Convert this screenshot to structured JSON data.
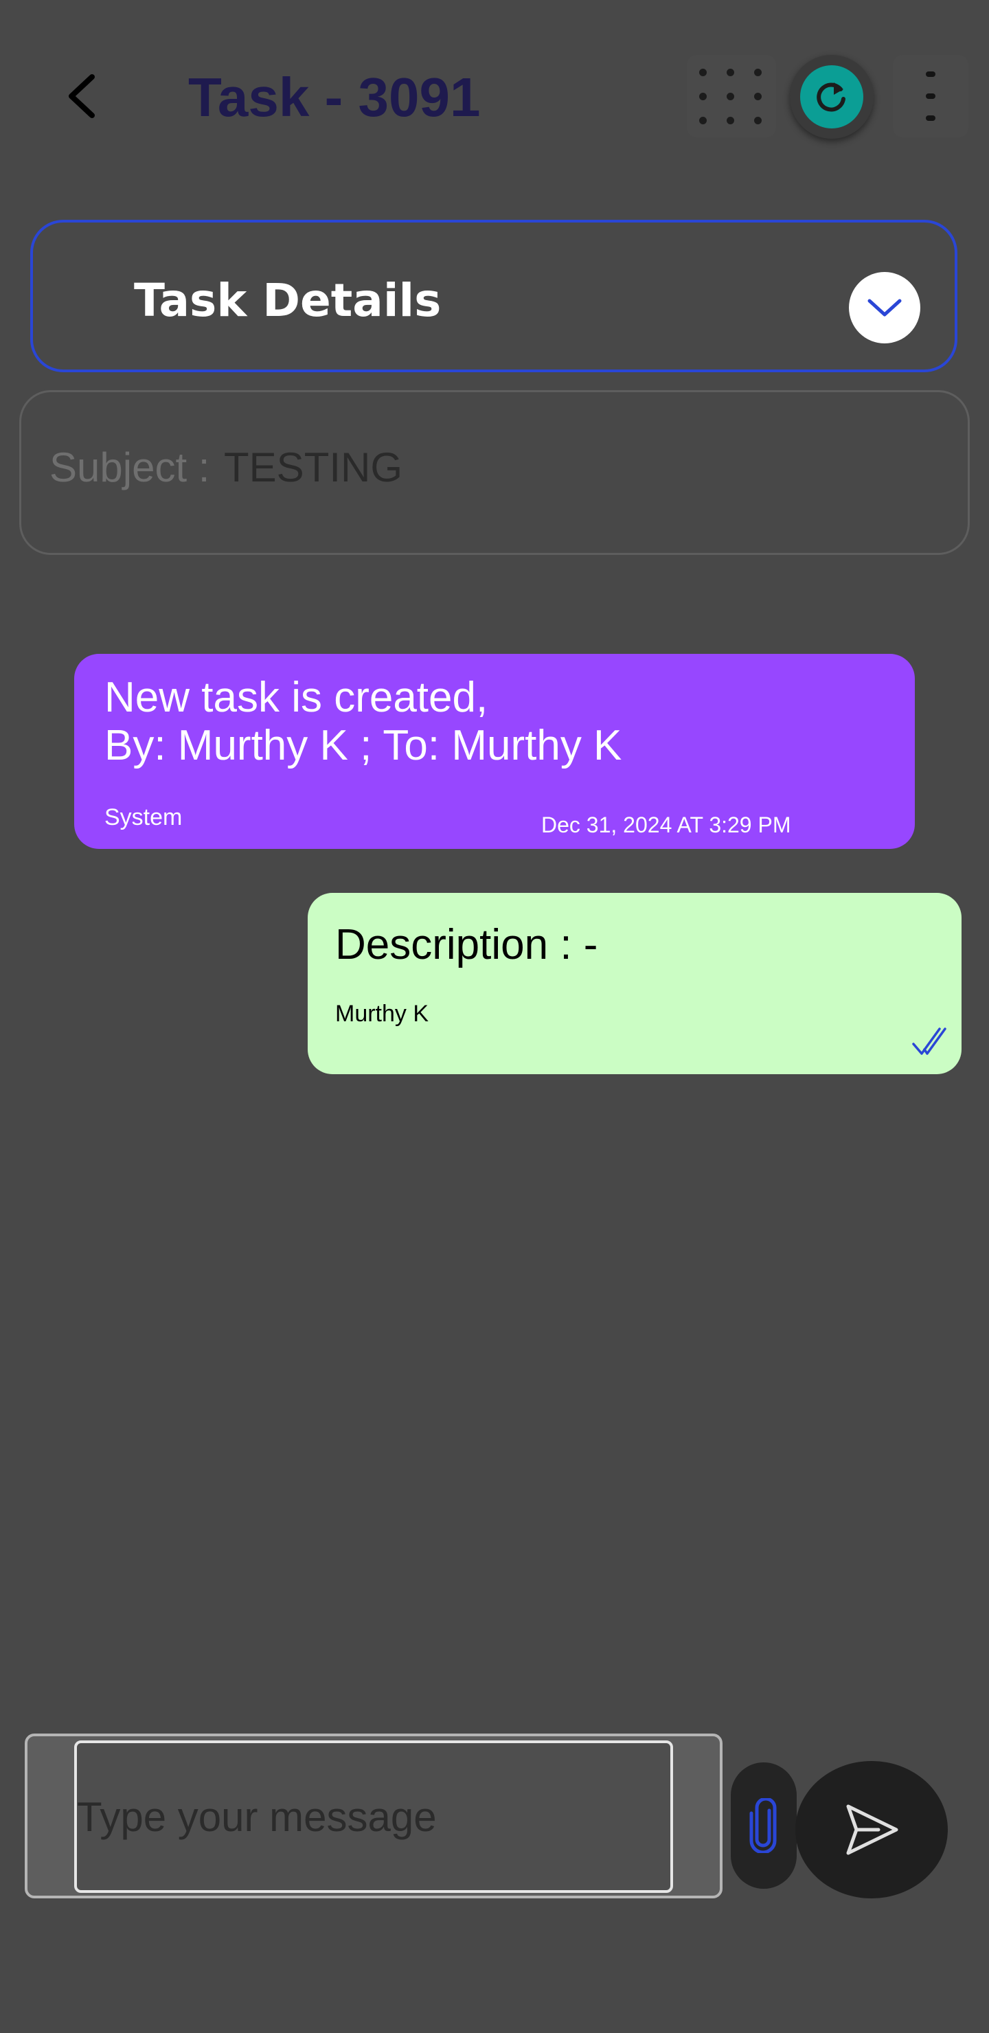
{
  "header": {
    "title": "Task - 3091",
    "back_icon": "chevron-left-icon",
    "grid_icon": "dot-grid-icon",
    "refresh_icon": "refresh-icon",
    "more_icon": "more-vertical-icon"
  },
  "details": {
    "title": "Task Details",
    "toggle_icon": "chevron-down-icon"
  },
  "subject": {
    "label": "Subject :",
    "value": "TESTING"
  },
  "messages": [
    {
      "type": "system",
      "line1": "New task is created,",
      "line2": "By: Murthy K ; To: Murthy K",
      "sender": "System",
      "timestamp": "Dec 31, 2024 AT 3:29 PM",
      "color": "#9747ff"
    },
    {
      "type": "outgoing",
      "text": "Description : -",
      "sender": "Murthy K",
      "status_icon": "double-check-icon",
      "color": "#cbfdc4"
    }
  ],
  "composer": {
    "placeholder": "Type your message",
    "attach_icon": "paperclip-icon",
    "send_icon": "send-icon"
  },
  "colors": {
    "background": "#484848",
    "accent_blue": "#2a46d6",
    "refresh_teal": "#0b9e95",
    "title_color": "#1e1a4e"
  }
}
